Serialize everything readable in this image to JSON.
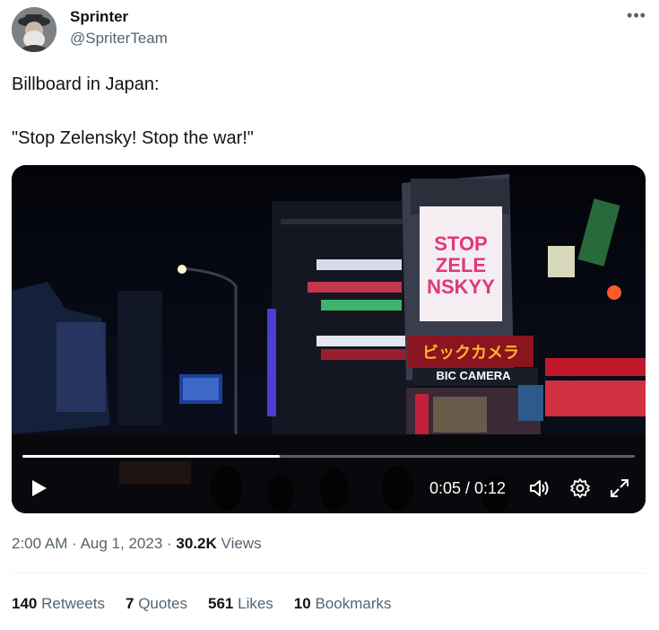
{
  "author": {
    "name": "Sprinter",
    "handle": "@SpriterTeam"
  },
  "tweet": {
    "line1": "Billboard in Japan:",
    "line2": "\"Stop Zelensky! Stop the war!\""
  },
  "video": {
    "billboard_text": [
      "STOP",
      "ZELE",
      "NSKYY"
    ],
    "store_sign_jp": "ビックカメラ",
    "store_sign_en": "BIC CAMERA",
    "time_display": "0:05 / 0:12",
    "progress": 0.42
  },
  "meta": {
    "time": "2:00 AM",
    "sep1": "·",
    "date": "Aug 1, 2023",
    "sep2": "·",
    "views_count": "30.2K",
    "views_label": "Views"
  },
  "stats": {
    "retweets_count": "140",
    "retweets_label": "Retweets",
    "quotes_count": "7",
    "quotes_label": "Quotes",
    "likes_count": "561",
    "likes_label": "Likes",
    "bookmarks_count": "10",
    "bookmarks_label": "Bookmarks"
  },
  "icons": {
    "more": "more-options-icon",
    "play": "play-icon",
    "volume": "volume-icon",
    "settings": "gear-icon",
    "fullscreen": "fullscreen-icon"
  },
  "colors": {
    "text": "#0f1419",
    "secondary": "#536471",
    "billboard_text": "#e0387a"
  }
}
